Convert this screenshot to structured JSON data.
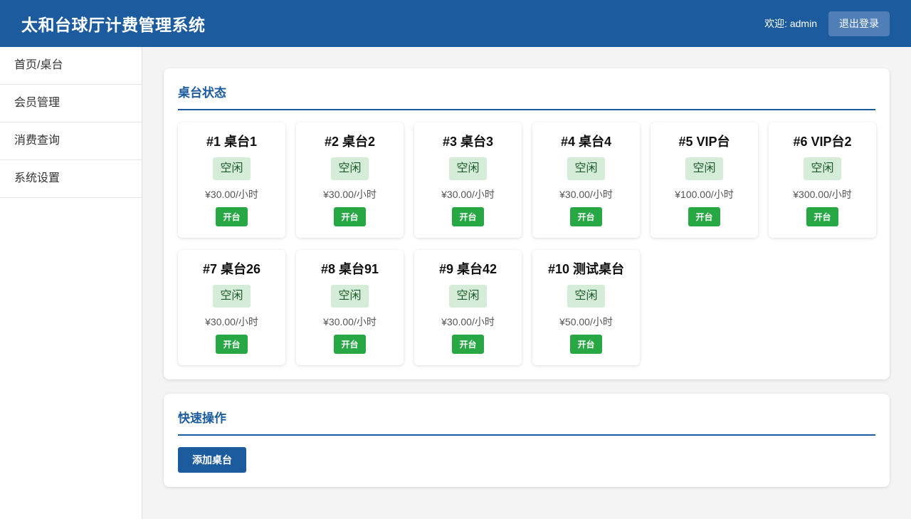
{
  "header": {
    "title": "太和台球厅计费管理系统",
    "welcome": "欢迎: admin",
    "logout_label": "退出登录"
  },
  "sidebar": {
    "items": [
      {
        "label": "首页/桌台"
      },
      {
        "label": "会员管理"
      },
      {
        "label": "消费查询"
      },
      {
        "label": "系统设置"
      }
    ]
  },
  "table_status": {
    "title": "桌台状态",
    "tables": [
      {
        "name": "#1 桌台1",
        "status": "空闲",
        "price": "¥30.00/小时",
        "action": "开台"
      },
      {
        "name": "#2 桌台2",
        "status": "空闲",
        "price": "¥30.00/小时",
        "action": "开台"
      },
      {
        "name": "#3 桌台3",
        "status": "空闲",
        "price": "¥30.00/小时",
        "action": "开台"
      },
      {
        "name": "#4 桌台4",
        "status": "空闲",
        "price": "¥30.00/小时",
        "action": "开台"
      },
      {
        "name": "#5 VIP台",
        "status": "空闲",
        "price": "¥100.00/小时",
        "action": "开台"
      },
      {
        "name": "#6 VIP台2",
        "status": "空闲",
        "price": "¥300.00/小时",
        "action": "开台"
      },
      {
        "name": "#7 桌台26",
        "status": "空闲",
        "price": "¥30.00/小时",
        "action": "开台"
      },
      {
        "name": "#8 桌台91",
        "status": "空闲",
        "price": "¥30.00/小时",
        "action": "开台"
      },
      {
        "name": "#9 桌台42",
        "status": "空闲",
        "price": "¥30.00/小时",
        "action": "开台"
      },
      {
        "name": "#10 测试桌台",
        "status": "空闲",
        "price": "¥50.00/小时",
        "action": "开台"
      }
    ]
  },
  "quick_actions": {
    "title": "快速操作",
    "add_table_label": "添加桌台"
  },
  "colors": {
    "primary": "#1b5b9e",
    "success": "#28a745",
    "idle_badge_bg": "#d4ecd8"
  }
}
